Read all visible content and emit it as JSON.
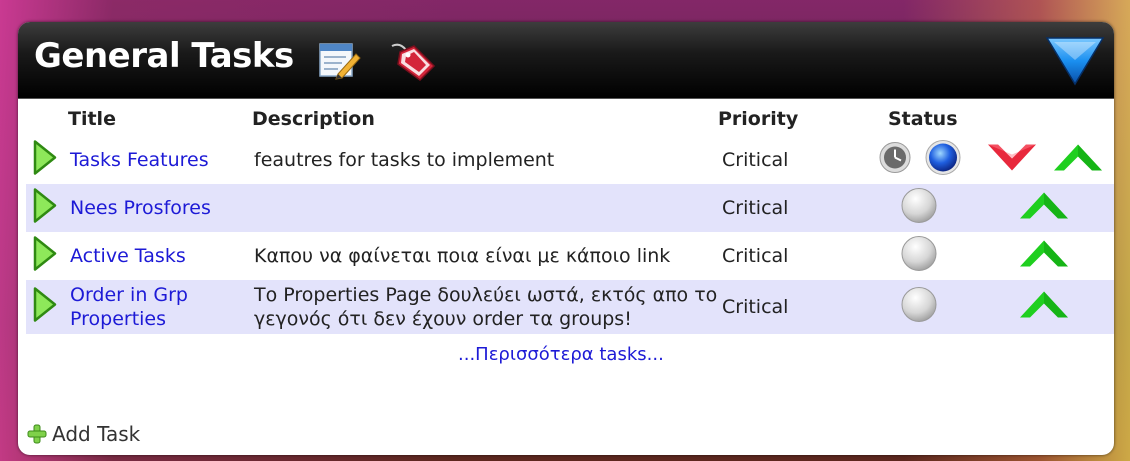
{
  "widget": {
    "title": "General Tasks",
    "header_icons": [
      "notepad-icon",
      "tag-icon"
    ],
    "collapse_icon": "blue-triangle-down-icon"
  },
  "columns": {
    "title": "Title",
    "description": "Description",
    "priority": "Priority",
    "status": "Status"
  },
  "tasks": [
    {
      "title": "Tasks Features",
      "description": "feautres for tasks to implement",
      "priority": "Critical",
      "status_icons": [
        "clock-icon",
        "blue-orb-icon"
      ],
      "arrows": [
        "red-down-arrow-icon",
        "green-up-arrow-icon"
      ]
    },
    {
      "title": "Nees Prosfores",
      "description": "",
      "priority": "Critical",
      "status_icons": [
        "grey-orb-icon"
      ],
      "arrows": [
        "green-up-arrow-icon"
      ]
    },
    {
      "title": "Active Tasks",
      "description": "Καπου να φαίνεται ποια είναι με κάποιο link",
      "priority": "Critical",
      "status_icons": [
        "grey-orb-icon"
      ],
      "arrows": [
        "green-up-arrow-icon"
      ]
    },
    {
      "title": "Order in Grp Properties",
      "description": "Το Properties Page δουλεύει ωστά, εκτός απο το γεγονός ότι δεν έχουν order τα groups!",
      "priority": "Critical",
      "status_icons": [
        "grey-orb-icon"
      ],
      "arrows": [
        "green-up-arrow-icon"
      ]
    }
  ],
  "more_link": "...Περισσότερα tasks...",
  "add_task_label": "Add Task",
  "colors": {
    "link": "#1d1ad6",
    "row_alt": "#e3e3fb",
    "header_bg": "#000000",
    "up_arrow": "#1fcf1f",
    "down_arrow": "#e8283c",
    "collapse": "#1a8ff0"
  }
}
